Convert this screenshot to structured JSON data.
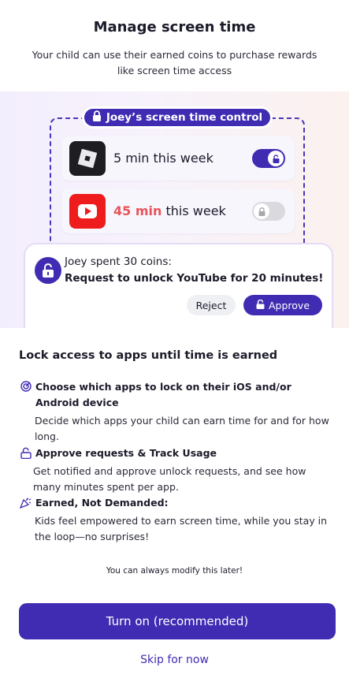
{
  "header": {
    "title": "Manage screen time",
    "subtitle": "Your child can use their earned coins to purchase rewards like screen time access"
  },
  "hero": {
    "control_label": "Joey’s screen time control",
    "apps": [
      {
        "name": "Roblox",
        "icon": "roblox-icon",
        "minutes_text": "5 min",
        "suffix": " this week",
        "locked": false,
        "toggle_on": true
      },
      {
        "name": "YouTube",
        "icon": "youtube-icon",
        "minutes_text": "45 min",
        "suffix": " this week",
        "locked": true,
        "toggle_on": false
      }
    ],
    "request": {
      "line1": "Joey spent 30 coins:",
      "line2": "Request to unlock YouTube for 20 minutes!",
      "reject_label": "Reject",
      "approve_label": "Approve"
    }
  },
  "section": {
    "title": "Lock access to apps until time is earned",
    "features": [
      {
        "icon": "target-icon",
        "heading": "Choose which apps to lock on their iOS and/or Android device",
        "body": "Decide which apps your child can earn time for and for how long."
      },
      {
        "icon": "unlock-icon",
        "heading": "Approve requests & Track Usage",
        "body": "Get notified and approve unlock requests, and see how many minutes spent per app."
      },
      {
        "icon": "party-popper-icon",
        "heading": "Earned, Not Demanded:",
        "body": "Kids feel empowered to earn screen time, while you stay in the loop—no surprises!"
      }
    ]
  },
  "footnote": "You can always modify this later!",
  "actions": {
    "primary_label": "Turn on (recommended)",
    "skip_label": "Skip for now"
  },
  "colors": {
    "accent": "#3f2cb3",
    "highlight_red": "#e8545a",
    "youtube_red": "#ee1c1c"
  }
}
